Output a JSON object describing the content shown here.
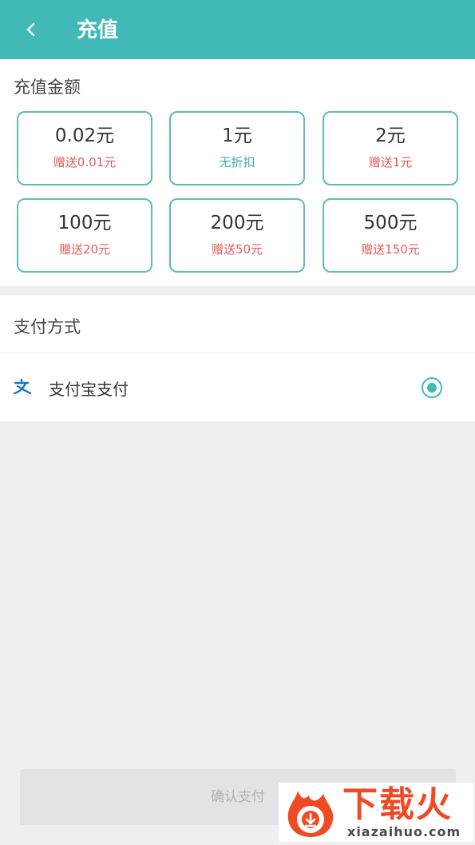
{
  "header": {
    "title": "充值"
  },
  "amount": {
    "label": "充值金额",
    "options": [
      {
        "amount": "0.02元",
        "sub": "赠送0.01元"
      },
      {
        "amount": "1元",
        "sub": "无折扣"
      },
      {
        "amount": "2元",
        "sub": "赠送1元"
      },
      {
        "amount": "100元",
        "sub": "赠送20元"
      },
      {
        "amount": "200元",
        "sub": "赠送50元"
      },
      {
        "amount": "500元",
        "sub": "赠送150元"
      }
    ]
  },
  "payment": {
    "label": "支付方式",
    "method": "支付宝支付",
    "method_icon": "alipay-icon",
    "selected": true
  },
  "confirm_label": "确认支付",
  "watermark": {
    "text": "下载火",
    "url": "xiazaihuo.com"
  },
  "colors": {
    "primary": "#41bab7",
    "gift": "#e15b5b",
    "no_discount": "#41aab7",
    "brand_watermark": "#f04a24"
  }
}
